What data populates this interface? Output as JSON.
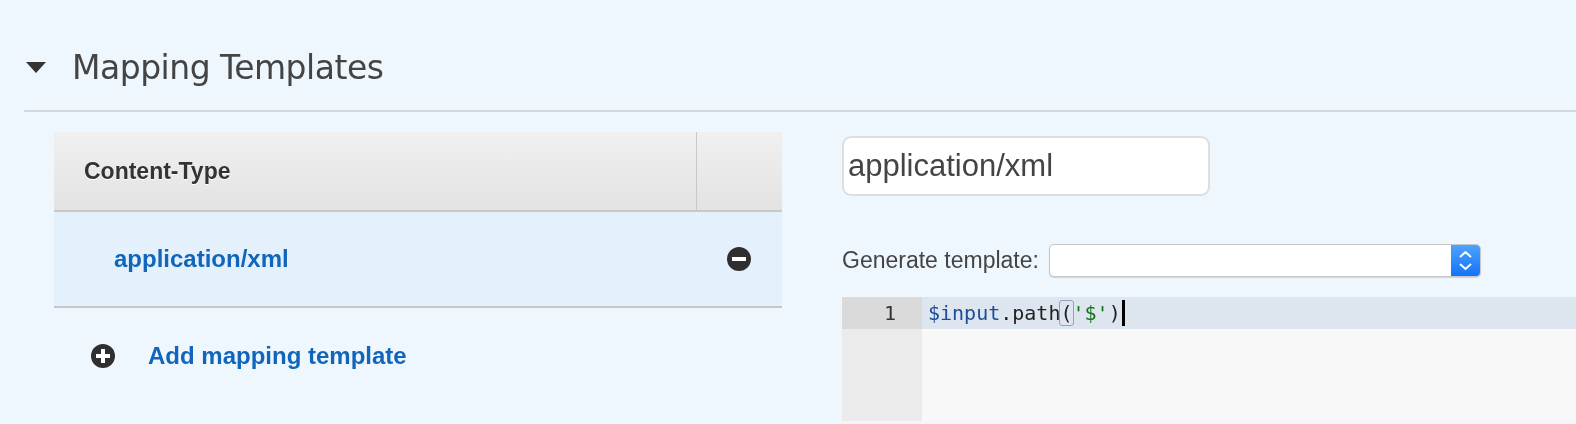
{
  "section": {
    "title": "Mapping Templates",
    "expanded": true
  },
  "table": {
    "columns": [
      "Content-Type"
    ],
    "rows": [
      {
        "content_type": "application/xml",
        "selected": true
      }
    ]
  },
  "add_link": "Add mapping template",
  "content_type_field": {
    "value": "application/xml"
  },
  "generate_template": {
    "label": "Generate template:"
  },
  "editor": {
    "lines": [
      {
        "number": "1",
        "active": true,
        "tokens": [
          {
            "text": "$input",
            "kind": "variable"
          },
          {
            "text": ".path",
            "kind": "plain"
          },
          {
            "text": "(",
            "kind": "bracket"
          },
          {
            "text": "'$'",
            "kind": "string"
          },
          {
            "text": ")",
            "kind": "plain"
          }
        ]
      }
    ]
  }
}
